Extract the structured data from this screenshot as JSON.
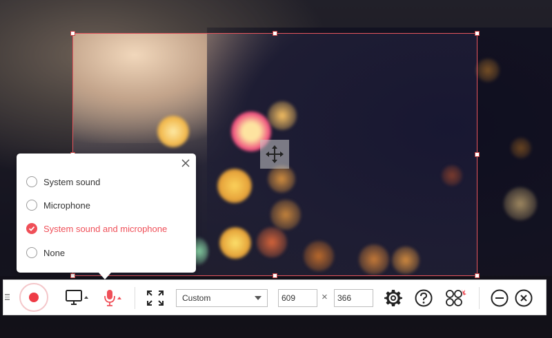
{
  "audio_popup": {
    "options": [
      {
        "label": "System sound",
        "selected": false
      },
      {
        "label": "Microphone",
        "selected": false
      },
      {
        "label": "System sound and microphone",
        "selected": true
      },
      {
        "label": "None",
        "selected": false
      }
    ],
    "close_icon": "close-icon"
  },
  "region": {
    "preset": "Custom",
    "width": "609",
    "height": "366",
    "times_symbol": "×"
  },
  "toolbar": {
    "icons": [
      "record-icon",
      "monitor-icon",
      "microphone-icon",
      "fullscreen-icon",
      "settings-icon",
      "help-icon",
      "more-tools-icon",
      "minimize-icon",
      "close-icon"
    ]
  },
  "colors": {
    "accent": "#ef4f58",
    "region_border": "#e8565e"
  }
}
